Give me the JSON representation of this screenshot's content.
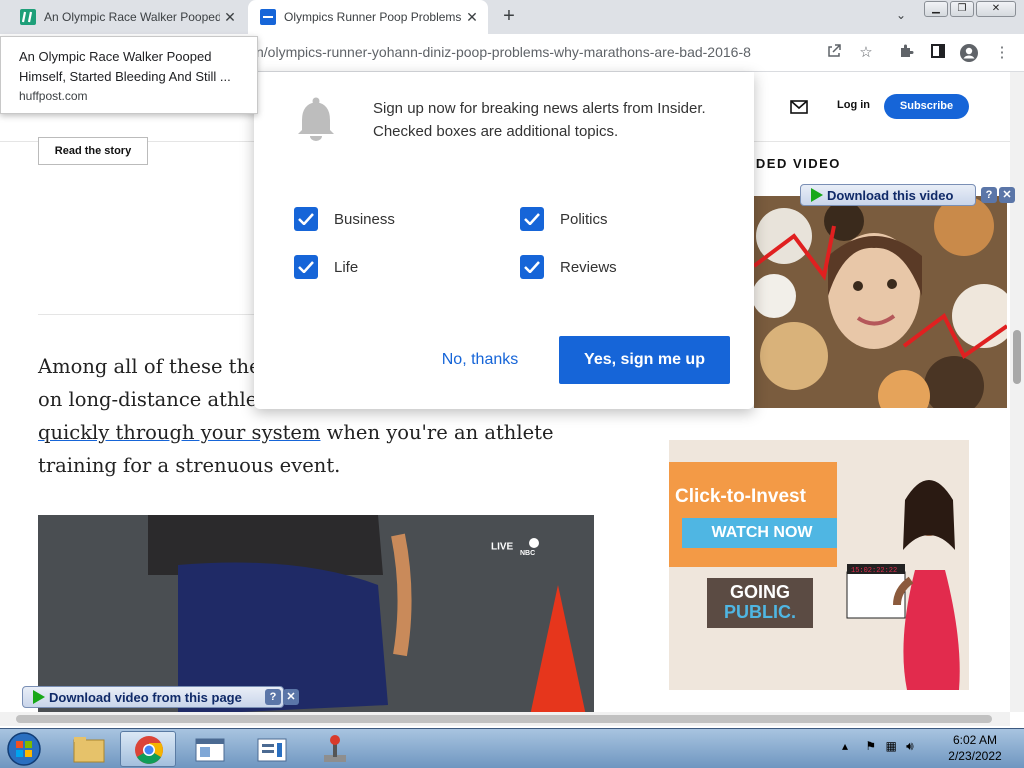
{
  "browser": {
    "tabs": [
      {
        "title": "An Olympic Race Walker Pooped",
        "close": "✕"
      },
      {
        "title": "Olympics Runner Poop Problems",
        "close": "✕"
      }
    ],
    "new_tab": "+",
    "tab_dropdown": "⌄",
    "window_buttons": {
      "minimize": "▁",
      "restore": "❐",
      "close": "✕"
    },
    "url": "n/olympics-runner-yohann-diniz-poop-problems-why-marathons-are-bad-2016-8"
  },
  "tooltip": {
    "title": "An Olympic Race Walker Pooped Himself, Started Bleeding And Still ...",
    "domain": "huffpost.com"
  },
  "site": {
    "login": "Log in",
    "subscribe": "Subscribe",
    "read_story": "Read the story",
    "recommended_label": "NDED VIDEO",
    "article_parts": {
      "p1": "Among all of these theo",
      "p2": "on long-distance athlet",
      "link": "quickly through your system",
      "p3": " when you're an athlete training for a strenuous event."
    },
    "video_overlay": "LIVE"
  },
  "ad": {
    "close": "✕",
    "headline": "Click-to-Invest",
    "cta": "WATCH NOW",
    "going": "GOING",
    "public": "PUBLIC."
  },
  "downloads": {
    "top": "Download this video",
    "bottom": "Download video from this page",
    "help": "?",
    "close": "✕"
  },
  "modal": {
    "message": "Sign up now for breaking news alerts from Insider. Checked boxes are additional topics.",
    "topics": [
      "Business",
      "Politics",
      "Life",
      "Reviews"
    ],
    "decline": "No, thanks",
    "accept": "Yes, sign me up"
  },
  "taskbar": {
    "time": "6:02 AM",
    "date": "2/23/2022"
  },
  "colors": {
    "accent": "#1665d8"
  }
}
